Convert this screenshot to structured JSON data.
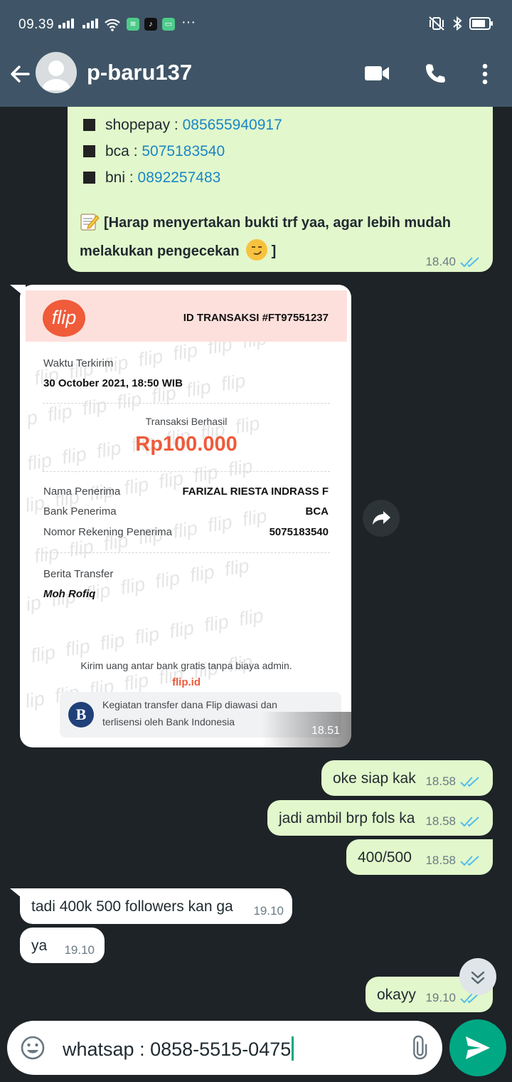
{
  "status": {
    "time": "09.39"
  },
  "header": {
    "contact_name": "p-baru137"
  },
  "messages": {
    "payment_block": {
      "shopepay_label": "shopepay : ",
      "shopepay_value": "085655940917",
      "bca_label": "bca : ",
      "bca_value": "5075183540",
      "bni_label": "bni : ",
      "bni_value": "0892257483",
      "note_line1": "[Harap menyertakan bukti trf yaa, agar lebih mudah",
      "note_line2": "melakukan pengecekan",
      "note_end": " ]",
      "time": "18.40"
    },
    "receipt": {
      "logo": "flip",
      "trx_id": "ID TRANSAKSI #FT97551237",
      "sent_label": "Waktu Terkirim",
      "sent_value": "30 October 2021, 18:50 WIB",
      "status": "Transaksi Berhasil",
      "amount": "Rp100.000",
      "recipient_label": "Nama Penerima",
      "recipient_value": "FARIZAL RIESTA INDRASS F",
      "bank_label": "Bank Penerima",
      "bank_value": "BCA",
      "account_label": "Nomor Rekening Penerima",
      "account_value": "5075183540",
      "note_label": "Berita Transfer",
      "note_value": "Moh Rofiq",
      "footer": "Kirim uang antar bank gratis tanpa biaya admin.",
      "footer_link": "flip.id",
      "bi_line1": "Kegiatan transfer dana Flip diawasi dan",
      "bi_line2": "terlisensi oleh Bank Indonesia",
      "time": "18.51"
    },
    "chat": [
      {
        "text": "oke siap kak",
        "time": "18.58"
      },
      {
        "text": "jadi ambil brp fols ka",
        "time": "18.58"
      },
      {
        "text": "400/500",
        "time": "18.58"
      },
      {
        "text": "tadi 400k 500 followers kan ga",
        "time": "19.10"
      },
      {
        "text": "ya",
        "time": "19.10"
      },
      {
        "text": "okayy",
        "time": "19.10"
      }
    ]
  },
  "composer": {
    "value": "whatsap : 0858-5515-0475"
  },
  "colors": {
    "header": "#3f5567",
    "outgoing": "#e2f7cb",
    "send": "#00a884",
    "tick": "#53bdeb",
    "flip": "#f05b3a"
  },
  "icons": [
    "back-arrow-icon",
    "video-call-icon",
    "phone-icon",
    "more-vert-icon",
    "emoji-icon",
    "attach-icon",
    "send-icon",
    "forward-icon",
    "chevron-down-icon"
  ]
}
